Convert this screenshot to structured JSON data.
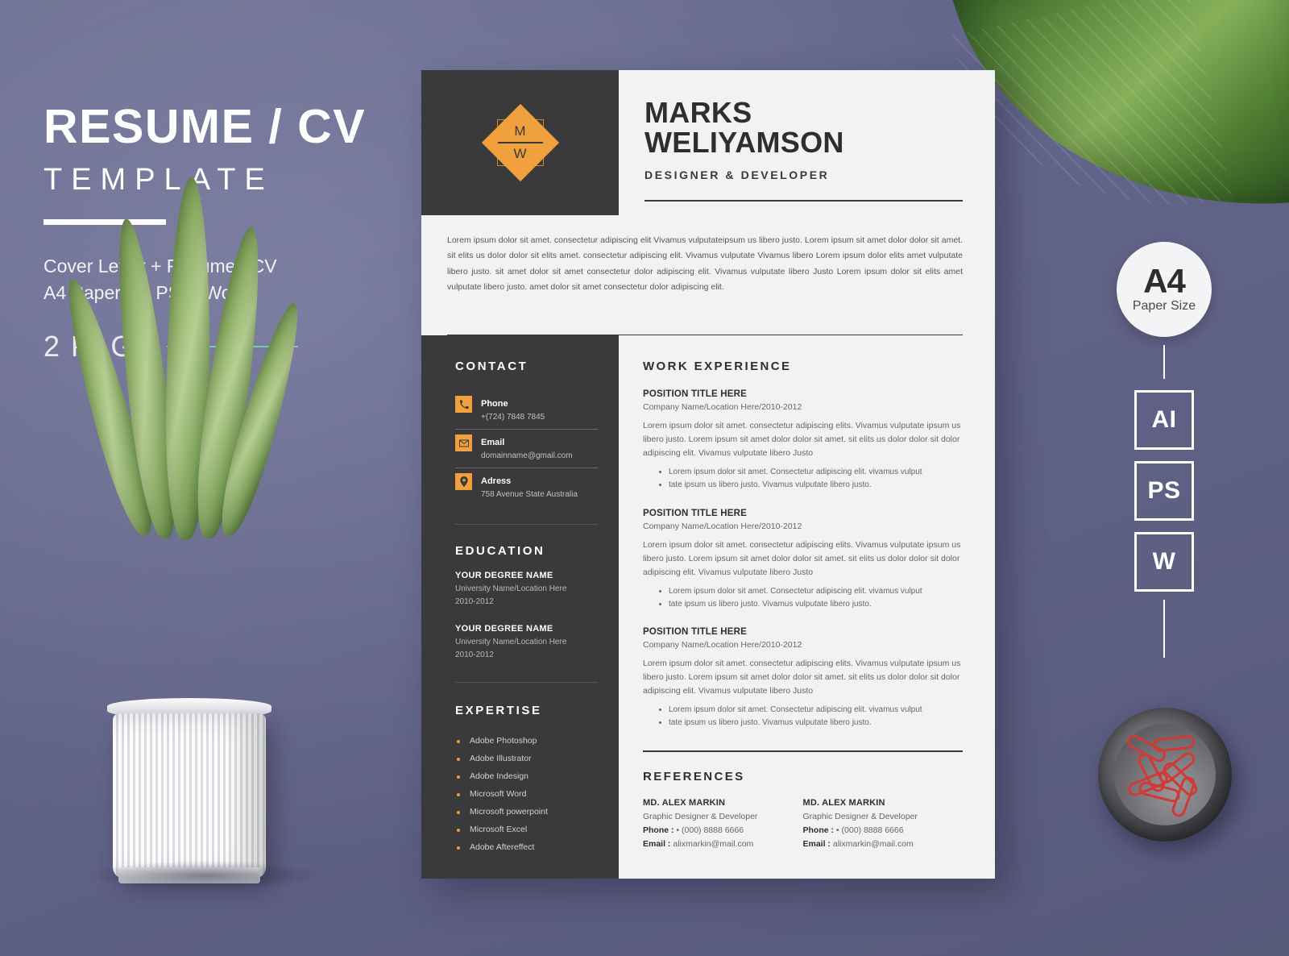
{
  "promo": {
    "title": "RESUME / CV",
    "subtitle": "TEMPLATE",
    "desc_line1": "Cover Letter + Resume / CV",
    "desc_line2": "A4 Paper, Ai, PSD, Word",
    "pages": "2 PAGE"
  },
  "badges": {
    "a4_main": "A4",
    "a4_sub": "Paper Size",
    "formats": [
      "AI",
      "PS",
      "W"
    ]
  },
  "resume": {
    "logo": {
      "letter_top": "M",
      "letter_bottom": "W"
    },
    "name_line1": "MARKS",
    "name_line2": "WELIYAMSON",
    "job_title": "DESIGNER & DEVELOPER",
    "profile": "Lorem ipsum dolor sit amet. consectetur adipiscing elit Vivamus vulputateipsum us libero justo. Lorem ipsum sit amet dolor dolor sit amet. sit elits us dolor dolor sit elits amet. consectetur adipiscing elit. Vivamus vulputate Vivamus libero Lorem ipsum dolor elits amet vulputate libero justo. sit amet dolor sit amet consectetur dolor adipiscing elit. Vivamus vulputate libero Justo Lorem ipsum dolor sit elits amet vulputate libero justo. amet dolor sit amet consectetur dolor adipiscing elit.",
    "contact": {
      "heading": "CONTACT",
      "items": [
        {
          "icon": "phone-icon",
          "glyph": "☎",
          "label": "Phone",
          "value": "+(724) 7848 7845"
        },
        {
          "icon": "email-icon",
          "glyph": "✉",
          "label": "Email",
          "value": "domainname@gmail.com"
        },
        {
          "icon": "location-pin-icon",
          "glyph": "●",
          "label": "Adress",
          "value": "758 Avenue State Australia"
        }
      ]
    },
    "education": {
      "heading": "EDUCATION",
      "items": [
        {
          "degree": "YOUR DEGREE NAME",
          "university": "University Name/Location Here",
          "years": "2010-2012"
        },
        {
          "degree": "YOUR DEGREE NAME",
          "university": "University Name/Location Here",
          "years": "2010-2012"
        }
      ]
    },
    "expertise": {
      "heading": "EXPERTISE",
      "items": [
        "Adobe Photoshop",
        "Adobe Illustrator",
        "Adobe Indesign",
        "Microsoft Word",
        "Microsoft powerpoint",
        "Microsoft Excel",
        "Adobe Aftereffect"
      ]
    },
    "work": {
      "heading": "WORK EXPERIENCE",
      "jobs": [
        {
          "title": "POSITION TITLE HERE",
          "meta": "Company Name/Location Here/2010-2012",
          "desc": "Lorem ipsum dolor sit amet. consectetur adipiscing elits. Vivamus vulputate ipsum us libero justo. Lorem ipsum sit amet dolor dolor sit amet. sit elits us dolor dolor sit dolor adipiscing elit. Vivamus vulputate libero Justo",
          "points": [
            "Lorem ipsum dolor sit amet. Consectetur adipiscing elit. vivamus vulput",
            "tate ipsum  us libero justo. Vivamus vulputate libero justo."
          ]
        },
        {
          "title": "POSITION TITLE HERE",
          "meta": "Company Name/Location Here/2010-2012",
          "desc": "Lorem ipsum dolor sit amet. consectetur adipiscing elits. Vivamus vulputate ipsum us libero justo. Lorem ipsum sit amet dolor dolor sit amet. sit elits us dolor dolor sit dolor adipiscing elit. Vivamus vulputate libero Justo",
          "points": [
            "Lorem ipsum dolor sit amet. Consectetur adipiscing elit. vivamus vulput",
            "tate ipsum  us libero justo. Vivamus vulputate libero justo."
          ]
        },
        {
          "title": "POSITION TITLE HERE",
          "meta": "Company Name/Location Here/2010-2012",
          "desc": "Lorem ipsum dolor sit amet. consectetur adipiscing elits. Vivamus vulputate ipsum us libero justo. Lorem ipsum sit amet dolor dolor sit amet. sit elits us dolor dolor sit dolor adipiscing elit. Vivamus vulputate libero Justo",
          "points": [
            "Lorem ipsum dolor sit amet. Consectetur adipiscing elit. vivamus vulput",
            "tate ipsum  us libero justo. Vivamus vulputate libero justo."
          ]
        }
      ]
    },
    "references": {
      "heading": "REFERENCES",
      "phone_label": "Phone :",
      "email_label": "Email :",
      "items": [
        {
          "name": "MD. ALEX MARKIN",
          "role": "Graphic Designer & Developer",
          "phone": "• (000) 8888 6666",
          "email": "alixmarkin@mail.com"
        },
        {
          "name": "MD. ALEX MARKIN",
          "role": "Graphic Designer & Developer",
          "phone": "• (000) 8888 6666",
          "email": "alixmarkin@mail.com"
        }
      ]
    }
  },
  "colors": {
    "background": "#6e7094",
    "dark": "#3a3a3c",
    "accent": "#f0a03c",
    "paper": "#f2f2f2",
    "teal_rule": "#7ec9b4"
  }
}
